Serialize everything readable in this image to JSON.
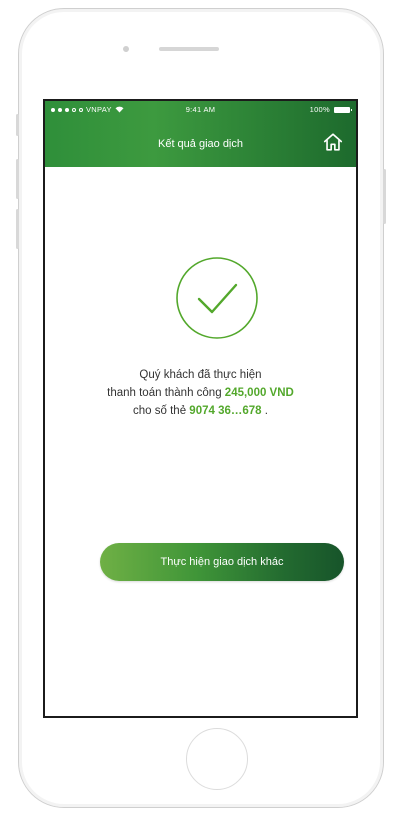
{
  "status_bar": {
    "carrier": "VNPAY",
    "time": "9:41 AM",
    "battery": "100%"
  },
  "header": {
    "title": "Kết quả giao dịch",
    "home_icon": "home-icon"
  },
  "result": {
    "icon": "checkmark-circle-icon",
    "line1": "Quý khách đã thực hiện",
    "line2_prefix": "thanh toán thành công ",
    "amount": "245,000 VND",
    "line3_prefix": "cho số thẻ ",
    "card_number": "9074 36…678",
    "line3_suffix": " ."
  },
  "actions": {
    "new_transaction_label": "Thực hiện giao dịch khác"
  },
  "colors": {
    "accent_green": "#53a82c",
    "header_green": "#2e8537",
    "frame_gray": "#cfcfcf"
  }
}
